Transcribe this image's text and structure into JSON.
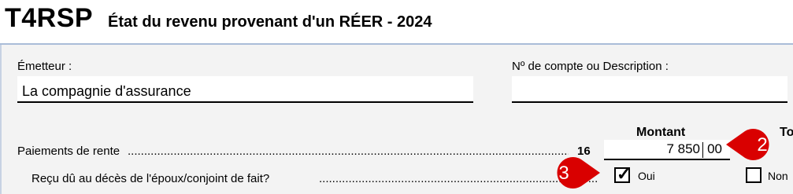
{
  "header": {
    "form_code": "T4RSP",
    "form_title": "État du revenu provenant d'un RÉER - 2024"
  },
  "issuer": {
    "label": "Émetteur :",
    "value": "La compagnie d'assurance"
  },
  "account": {
    "label": "Nº de compte ou Description :",
    "value": ""
  },
  "columns": {
    "amount_header": "Montant",
    "next_header_partial": "To"
  },
  "annuity": {
    "label": "Paiements de rente",
    "box_number": "16",
    "amount_dollars": "7 850",
    "amount_cents": "00"
  },
  "spouse_death": {
    "question": "Reçu dû au décès de l'époux/conjoint de fait?",
    "yes_label": "Oui",
    "no_label": "Non",
    "yes_checked": true,
    "no_checked": false
  },
  "callouts": {
    "badge_2": "2",
    "badge_3": "3",
    "color": "#d90000"
  }
}
